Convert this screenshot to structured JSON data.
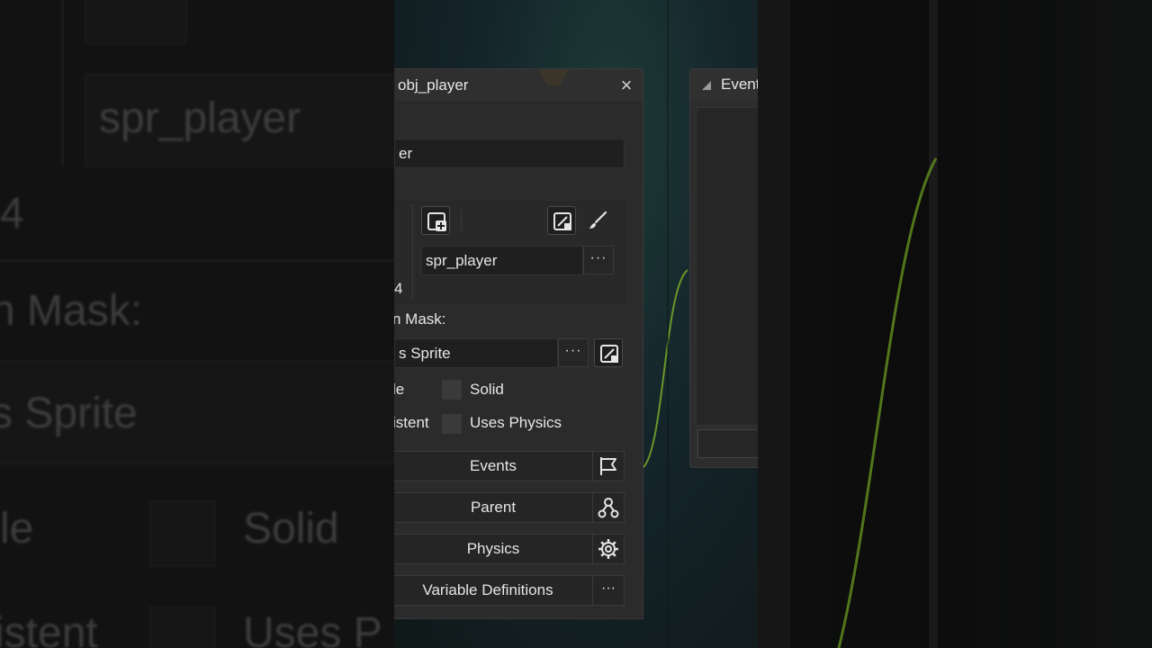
{
  "left_zoom": {
    "sprite_name": "spr_player",
    "number": "4",
    "mask_label": "n Mask:",
    "mask_value": "s Sprite",
    "visible_label": "le",
    "solid_label": "Solid",
    "persistent_label": "istent",
    "physics_label": "Uses P"
  },
  "object_panel": {
    "title": "obj_player",
    "name_value": "er",
    "sprite": {
      "value": "spr_player",
      "browse_label": "···",
      "new_icon": "new-sprite-icon",
      "edit_icon": "edit-image-icon",
      "brush_icon": "paint-brush-icon"
    },
    "subimage_count": "4",
    "collision_mask": {
      "label": "n Mask:",
      "value": "s Sprite",
      "browse_label": "···",
      "edit_icon": "edit-mask-icon"
    },
    "checkboxes": {
      "visible_label": "le",
      "solid_label": "Solid",
      "persistent_label": "istent",
      "physics_label": "Uses Physics"
    },
    "buttons": [
      {
        "label": "Events",
        "icon": "flag-icon"
      },
      {
        "label": "Parent",
        "icon": "hierarchy-icon"
      },
      {
        "label": "Physics",
        "icon": "gear-icon"
      },
      {
        "label": "Variable Definitions",
        "icon": "more-icon",
        "icon_text": "···"
      }
    ],
    "close_icon": "close-icon"
  },
  "events_panel": {
    "title": "Events"
  },
  "colors": {
    "panel_bg": "#2b2b2b",
    "field_bg": "#1f1f1f",
    "curve": "#7fb32a",
    "workspace": "#14242a"
  }
}
